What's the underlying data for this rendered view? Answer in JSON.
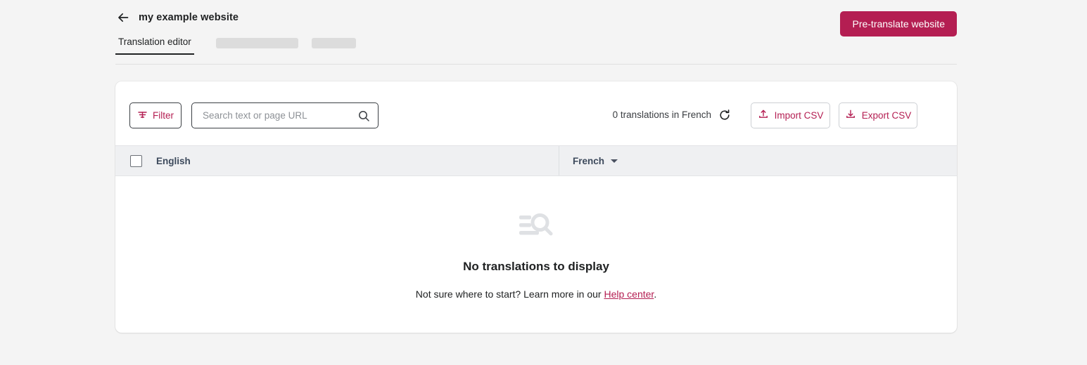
{
  "header": {
    "back_icon": "arrow-left-icon",
    "title": "my example website",
    "pretranslate_label": "Pre-translate website"
  },
  "tabs": {
    "active_label": "Translation editor",
    "skeletons": 2
  },
  "toolbar": {
    "filter_label": "Filter",
    "filter_icon": "filter-icon",
    "search_placeholder": "Search text or page URL",
    "search_value": "",
    "search_icon": "search-icon",
    "count_text": "0 translations in French",
    "refresh_icon": "refresh-icon",
    "import_label": "Import CSV",
    "import_icon": "upload-icon",
    "export_label": "Export CSV",
    "export_icon": "download-icon"
  },
  "table": {
    "source_column": "English",
    "target_column": "French",
    "target_has_dropdown": true,
    "select_all_checked": false,
    "rows": []
  },
  "empty_state": {
    "icon": "list-search-icon",
    "title": "No translations to display",
    "subtitle_prefix": "Not sure where to start? Learn more in our ",
    "link_label": "Help center",
    "subtitle_suffix": "."
  },
  "colors": {
    "accent": "#b41e52",
    "page_background": "#f4f4f4",
    "card_background": "#ffffff",
    "table_header_background": "#eff0f2",
    "skeleton": "#dcdcdc",
    "empty_icon": "#dfe1e4"
  }
}
